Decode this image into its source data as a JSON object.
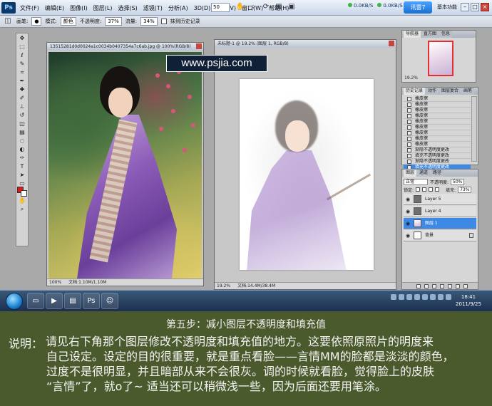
{
  "menubar": {
    "app_logo": "Ps",
    "items": [
      "文件(F)",
      "编辑(E)",
      "图像(I)",
      "图层(L)",
      "选择(S)",
      "滤镜(T)",
      "分析(A)",
      "3D(D)",
      "视图(V)",
      "窗口(W)",
      "帮助(H)"
    ],
    "zoom_value": "50",
    "speed_up": "0.0KB/S",
    "speed_down": "0.0KB/S",
    "net_button": "讯雷7",
    "workspace": "基本功能"
  },
  "optionsbar": {
    "brush_label": "画笔:",
    "mode_label": "模式:",
    "mode_value": "颜色",
    "opacity_label": "不透明度:",
    "opacity_value": "37%",
    "flow_label": "流量:",
    "flow_value": "34%",
    "history_checkbox": "抹到历史记录"
  },
  "doc1": {
    "title": "13515281d0d0024a1c0034b0407354a7c6ab.jpg @ 100%(RGB/8)",
    "status_zoom": "100%",
    "status_doc": "文档:1.10M/1.10M"
  },
  "watermark": "www.psjia.com",
  "doc2": {
    "title": "未标题-1 @ 19.2% (图层 1, RGB/8)",
    "status_zoom": "19.2%",
    "status_doc": "文档:14.4M/38.4M"
  },
  "navigator": {
    "tabs": [
      "导航器",
      "直方图",
      "信息"
    ],
    "zoom": "19.2%"
  },
  "history": {
    "tabs": [
      "历史记录",
      "动作",
      "图层复合",
      "画笔"
    ],
    "items": [
      "橡皮擦",
      "橡皮擦",
      "橡皮擦",
      "橡皮擦",
      "橡皮擦",
      "橡皮擦",
      "橡皮擦",
      "橡皮擦",
      "橡皮擦",
      "渐隐不透明度更改",
      "填充不透明度更改",
      "渐隐不透明度更改",
      "填充不透明度更改"
    ],
    "selected_index": 12
  },
  "layers": {
    "tabs": [
      "图层",
      "通道",
      "路径"
    ],
    "blend_mode": "正常",
    "opacity_label": "不透明度:",
    "opacity_value": "50%",
    "lock_label": "锁定:",
    "fill_label": "填充:",
    "fill_value": "73%",
    "items": [
      {
        "name": "Layer 5",
        "selected": false
      },
      {
        "name": "Layer 4",
        "selected": false
      },
      {
        "name": "图层 1",
        "selected": true
      },
      {
        "name": "背景",
        "selected": false
      }
    ]
  },
  "taskbar": {
    "time": "18:41",
    "date": "2011/9/25"
  },
  "caption": {
    "step_title": "第五步：减小图层不透明度和填充值",
    "desc_label": "说明：",
    "lines": [
      "请见右下角那个图层修改不透明度和填充值的地方。这要依照原照片的明度来",
      "自己设定。设定的目的很重要，就是重点看脸——言情MM的脸都是淡淡的颜色，",
      "过度不是很明显，并且暗部从来不会很灰。调的时候就看脸，觉得脸上的皮肤",
      "“言情”了，就o了~ 适当还可以稍微浅一些，因为后面还要用笔涂。"
    ]
  }
}
